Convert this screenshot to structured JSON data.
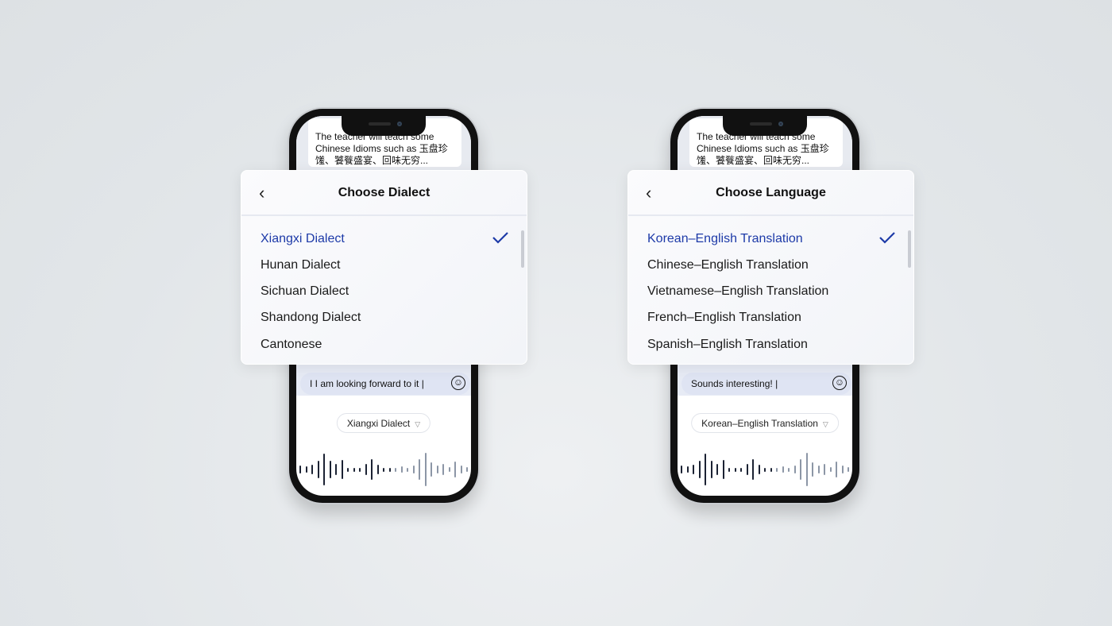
{
  "accent": "#1d3aa8",
  "phones": [
    {
      "bubble_text": "The teacher will teach some Chinese Idioms such as 玉盘珍馐、饕餮盛宴、回味无穷...",
      "input_value": "I I am looking forward to it |",
      "selector_label": "Xiangxi Dialect",
      "card": {
        "title": "Choose Dialect",
        "items": [
          "Xiangxi Dialect",
          "Hunan Dialect",
          "Sichuan Dialect",
          "Shandong Dialect",
          "Cantonese"
        ],
        "selected": "Xiangxi Dialect"
      }
    },
    {
      "bubble_text": "The teacher will teach some Chinese Idioms such as 玉盘珍馐、饕餮盛宴、回味无穷...",
      "input_value": "Sounds interesting! |",
      "selector_label": "Korean–English Translation",
      "card": {
        "title": "Choose Language",
        "items": [
          "Korean–English Translation",
          "Chinese–English Translation",
          "Vietnamese–English Translation",
          "French–English Translation",
          "Spanish–English Translation"
        ],
        "selected": "Korean–English Translation"
      }
    }
  ],
  "icons": {
    "back": "chevron-left-icon",
    "check": "checkmark-icon",
    "emoji": "smiley-icon",
    "dropdown": "chevron-down-icon"
  }
}
